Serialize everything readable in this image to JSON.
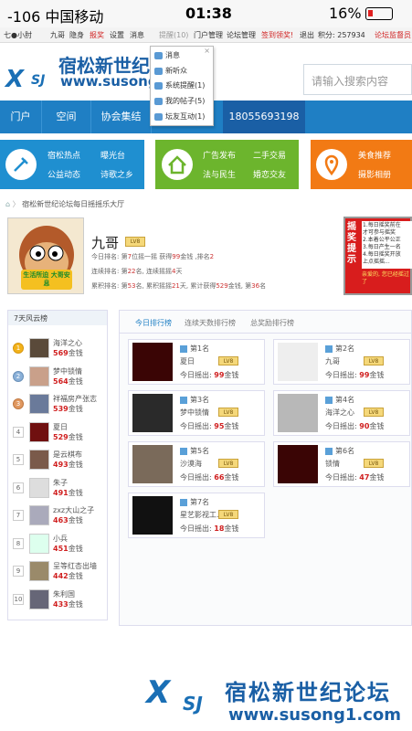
{
  "status_bar": {
    "carrier": "-106 中国移动",
    "time": "01:38",
    "battery": "16%"
  },
  "toolbar": {
    "items": [
      "七●小肘",
      "九哥",
      "隐身",
      "报奖",
      "设置",
      "消息",
      "提醒(10)",
      "门户管理",
      "论坛管理",
      "签到领奖!",
      "退出",
      "积分: 257934",
      "论坛监督员"
    ]
  },
  "dropdown": {
    "items": [
      "消息",
      "新听众",
      "系统提醒(1)",
      "我的帖子(5)",
      "坛友互动(1)"
    ]
  },
  "header": {
    "logo_cn": "宿松新世纪论",
    "logo_url": "www.susong1.c",
    "logo_x": "X",
    "logo_sj": "SJ",
    "search_placeholder": "请输入搜索内容"
  },
  "nav": {
    "items": [
      "门户",
      "空间",
      "协会集结"
    ],
    "phone": "18055693198"
  },
  "categories": {
    "blue": [
      "宿松热点",
      "曝光台",
      "公益动态",
      "诗歌之乡"
    ],
    "green": [
      "广告发布",
      "二手交易",
      "法与民生",
      "婚恋交友"
    ],
    "orange": [
      "美食推荐",
      "摄影相册"
    ]
  },
  "breadcrumb": "宿松新世纪论坛每日摇摇乐大厅",
  "profile": {
    "avatar_text": "生活所迫 大哥安息",
    "name": "九哥",
    "level": "LV8",
    "today_rank": "今日排名: 第7位摇一摇 获得99金钱 ,排名2",
    "today_prefix": "今日排名: 第",
    "today_pos": "7",
    "today_mid": "位摇一摇 获得",
    "today_coins": "99",
    "today_suffix": "金钱 ,排名",
    "today_place": "2",
    "streak_prefix": "连续排名: 第",
    "streak_rank": "22",
    "streak_mid": "名, 连续摇摇",
    "streak_days": "4",
    "streak_suffix": "天",
    "total_prefix": "累积排名: 第",
    "total_rank": "53",
    "total_mid1": "名, 累积摇摇",
    "total_days": "21",
    "total_mid2": "天, 累计获得",
    "total_coins": "529",
    "total_mid3": "金钱, 第",
    "total_place": "36",
    "total_suffix": "名"
  },
  "notice": {
    "title": "摇奖提示",
    "lines": [
      "1.每日摇奖前在",
      "才可参与摇奖",
      "2.本着公平公正",
      "3.每日产生一名",
      "4.每日摇奖开放",
      "上点摇摇..."
    ],
    "footer": "亲爱的, 您已经摇过了"
  },
  "leftlist": {
    "title": "7天风云榜",
    "rows": [
      {
        "rank": "1",
        "name": "海洋之心",
        "coins": "569",
        "unit": "金钱"
      },
      {
        "rank": "2",
        "name": "梦中锁情",
        "coins": "564",
        "unit": "金钱"
      },
      {
        "rank": "3",
        "name": "祥福房产张志",
        "coins": "539",
        "unit": "金钱"
      },
      {
        "rank": "4",
        "name": "夏日",
        "coins": "529",
        "unit": "金钱"
      },
      {
        "rank": "5",
        "name": "是云棋布",
        "coins": "493",
        "unit": "金钱"
      },
      {
        "rank": "6",
        "name": "朱子",
        "coins": "491",
        "unit": "金钱"
      },
      {
        "rank": "7",
        "name": "zxz大山之子",
        "coins": "463",
        "unit": "金钱"
      },
      {
        "rank": "8",
        "name": "小兵",
        "coins": "451",
        "unit": "金钱"
      },
      {
        "rank": "9",
        "name": "呈等红杏出墙",
        "coins": "442",
        "unit": "金钱"
      },
      {
        "rank": "10",
        "name": "朱利国",
        "coins": "433",
        "unit": "金钱"
      }
    ]
  },
  "tabs": [
    "今日排行榜",
    "连续天数排行榜",
    "总奖励排行榜"
  ],
  "cards": [
    {
      "rank": "第1名",
      "name": "夏日",
      "level": "LV8",
      "label": "今日摇出:",
      "coins": "99",
      "unit": "金钱"
    },
    {
      "rank": "第2名",
      "name": "九哥",
      "level": "LV8",
      "label": "今日摇出:",
      "coins": "99",
      "unit": "金钱"
    },
    {
      "rank": "第3名",
      "name": "梦中锁情",
      "level": "LV8",
      "label": "今日摇出:",
      "coins": "95",
      "unit": "金钱"
    },
    {
      "rank": "第4名",
      "name": "海洋之心",
      "level": "LV8",
      "label": "今日摇出:",
      "coins": "90",
      "unit": "金钱"
    },
    {
      "rank": "第5名",
      "name": "沙漠海",
      "level": "LV8",
      "label": "今日摇出:",
      "coins": "66",
      "unit": "金钱"
    },
    {
      "rank": "第6名",
      "name": "锁情",
      "level": "LV8",
      "label": "今日摇出:",
      "coins": "47",
      "unit": "金钱"
    },
    {
      "rank": "第7名",
      "name": "星艺影视工...",
      "level": "LV8",
      "label": "今日摇出:",
      "coins": "18",
      "unit": "金钱"
    }
  ],
  "footer": {
    "x": "X",
    "sj": "SJ",
    "cn": "宿松新世纪论坛",
    "url": "www.susong1.com"
  }
}
